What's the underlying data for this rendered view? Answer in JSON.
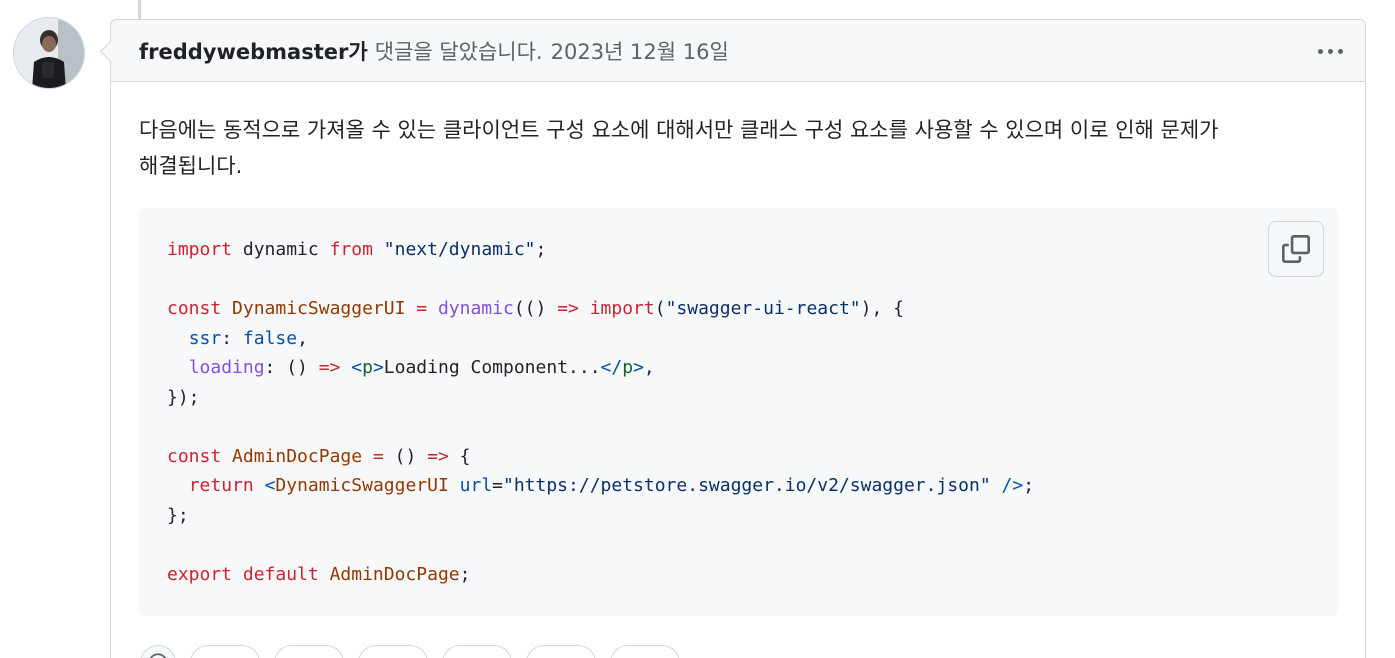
{
  "comment": {
    "author": "freddywebmaster가",
    "action": "댓글을 달았습니다.",
    "date": "2023년 12월 16일",
    "body_lines": [
      "다음에는 동적으로 가져올 수 있는 클라이언트 구성 요소에 대해서만 클래스 구성 요소를 사용할 수 있으며 이로 인해 문제가",
      "해결됩니다."
    ]
  },
  "code": {
    "lines": [
      [
        {
          "t": "import",
          "c": "kw"
        },
        {
          "t": " dynamic "
        },
        {
          "t": "from",
          "c": "kw"
        },
        {
          "t": " "
        },
        {
          "t": "\"next/dynamic\"",
          "c": "str"
        },
        {
          "t": ";"
        }
      ],
      [],
      [
        {
          "t": "const",
          "c": "kw"
        },
        {
          "t": " "
        },
        {
          "t": "DynamicSwaggerUI",
          "c": "ent"
        },
        {
          "t": " "
        },
        {
          "t": "=",
          "c": "kw"
        },
        {
          "t": " "
        },
        {
          "t": "dynamic",
          "c": "fn"
        },
        {
          "t": "(() "
        },
        {
          "t": "=>",
          "c": "kw"
        },
        {
          "t": " "
        },
        {
          "t": "import",
          "c": "kw"
        },
        {
          "t": "("
        },
        {
          "t": "\"swagger-ui-react\"",
          "c": "str"
        },
        {
          "t": "), {"
        }
      ],
      [
        {
          "t": "  "
        },
        {
          "t": "ssr",
          "c": "cst"
        },
        {
          "t": ": "
        },
        {
          "t": "false",
          "c": "cst"
        },
        {
          "t": ","
        }
      ],
      [
        {
          "t": "  "
        },
        {
          "t": "loading",
          "c": "fn"
        },
        {
          "t": ": () "
        },
        {
          "t": "=>",
          "c": "kw"
        },
        {
          "t": " "
        },
        {
          "t": "<",
          "c": "cst"
        },
        {
          "t": "p",
          "c": "tag"
        },
        {
          "t": ">",
          "c": "cst"
        },
        {
          "t": "Loading Component..."
        },
        {
          "t": "</",
          "c": "cst"
        },
        {
          "t": "p",
          "c": "tag"
        },
        {
          "t": ">",
          "c": "cst"
        },
        {
          "t": ","
        }
      ],
      [
        {
          "t": "});"
        }
      ],
      [],
      [
        {
          "t": "const",
          "c": "kw"
        },
        {
          "t": " "
        },
        {
          "t": "AdminDocPage",
          "c": "ent"
        },
        {
          "t": " "
        },
        {
          "t": "=",
          "c": "kw"
        },
        {
          "t": " () "
        },
        {
          "t": "=>",
          "c": "kw"
        },
        {
          "t": " {"
        }
      ],
      [
        {
          "t": "  "
        },
        {
          "t": "return",
          "c": "kw"
        },
        {
          "t": " "
        },
        {
          "t": "<",
          "c": "cst"
        },
        {
          "t": "DynamicSwaggerUI",
          "c": "ent"
        },
        {
          "t": " "
        },
        {
          "t": "url",
          "c": "cst"
        },
        {
          "t": "="
        },
        {
          "t": "\"https://petstore.swagger.io/v2/swagger.json\"",
          "c": "str"
        },
        {
          "t": " "
        },
        {
          "t": "/>",
          "c": "cst"
        },
        {
          "t": ";"
        }
      ],
      [
        {
          "t": "};"
        }
      ],
      [],
      [
        {
          "t": "export",
          "c": "kw"
        },
        {
          "t": " "
        },
        {
          "t": "default",
          "c": "kw"
        },
        {
          "t": " "
        },
        {
          "t": "AdminDocPage",
          "c": "ent"
        },
        {
          "t": ";"
        }
      ]
    ]
  },
  "icons": {
    "more": "kebab-horizontal-icon",
    "copy": "copy-icon",
    "add_reaction": "smiley-icon"
  },
  "reactions": {
    "count": 6
  },
  "colors": {
    "header_bg": "#f6f8fa",
    "border": "#d0d7de",
    "code_bg": "#f6f8fa",
    "keyword": "#cf222e",
    "function": "#8250df",
    "entity": "#953800",
    "string": "#0a3069",
    "constant": "#0550ae",
    "tag": "#116329"
  }
}
